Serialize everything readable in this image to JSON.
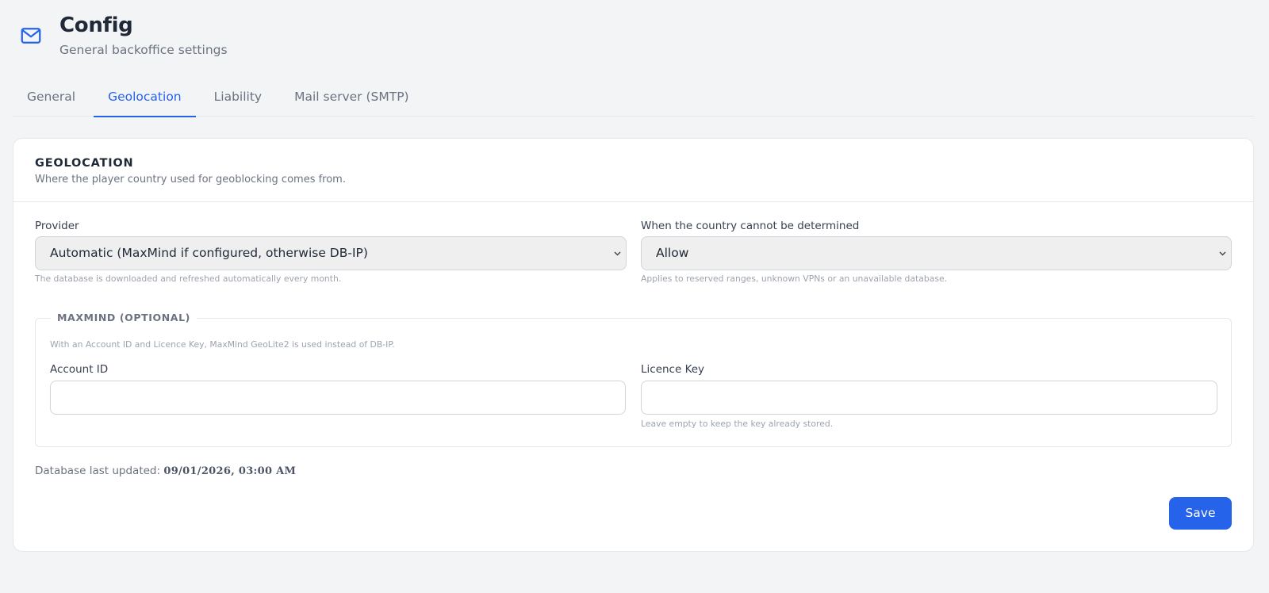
{
  "header": {
    "icon": "mail-icon",
    "title": "Config",
    "subtitle": "General backoffice settings"
  },
  "tabs": [
    {
      "label": "General",
      "active": false
    },
    {
      "label": "Geolocation",
      "active": true
    },
    {
      "label": "Liability",
      "active": false
    },
    {
      "label": "Mail server (SMTP)",
      "active": false
    }
  ],
  "section": {
    "title": "GEOLOCATION",
    "description": "Where the player country used for geoblocking comes from."
  },
  "provider": {
    "label": "Provider",
    "value": "Automatic (MaxMind if configured, otherwise DB-IP)",
    "help": "The database is downloaded and refreshed automatically every month."
  },
  "fallback": {
    "label": "When the country cannot be determined",
    "value": "Allow",
    "help": "Applies to reserved ranges, unknown VPNs or an unavailable database."
  },
  "maxmind": {
    "legend": "MAXMIND (OPTIONAL)",
    "note": "With an Account ID and Licence Key, MaxMind GeoLite2 is used instead of DB-IP.",
    "account_id": {
      "label": "Account ID",
      "value": ""
    },
    "licence_key": {
      "label": "Licence Key",
      "value": "",
      "help": "Leave empty to keep the key already stored."
    }
  },
  "db_status": {
    "label": "Database last updated:",
    "value": "09/01/2026, 03:00 AM"
  },
  "actions": {
    "save_label": "Save"
  },
  "colors": {
    "accent": "#2563eb",
    "background": "#f3f4f6"
  }
}
